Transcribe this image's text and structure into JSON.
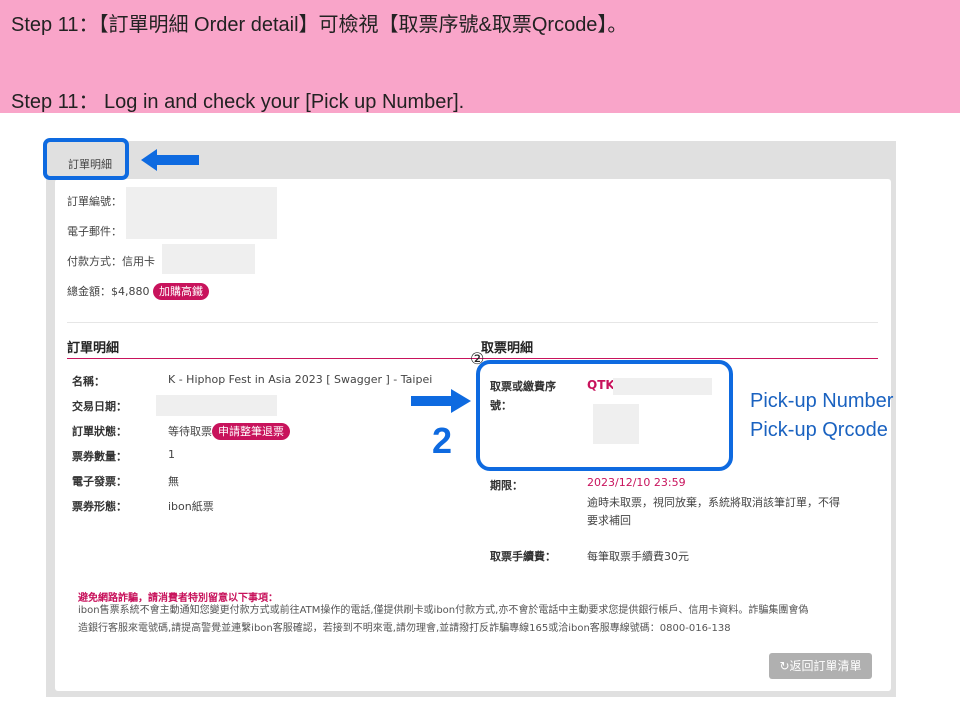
{
  "banner": {
    "line1": "Step 11：【訂單明細 Order detail】可檢視【取票序號&取票Qrcode】。",
    "line2": "Step 11： Log in and check your [Pick up Number]."
  },
  "tab": {
    "label": "訂單明細"
  },
  "summary": {
    "order_no_label": "訂單編號：",
    "email_label": "電子郵件：",
    "payment_label": "付款方式：信用卡",
    "total_label": "總金額：$4,880",
    "upsell_badge": "加購高鐵"
  },
  "order_detail": {
    "title": "訂單明細",
    "rows": [
      {
        "label": "名稱：",
        "value": "K - Hiphop  Fest  in  Asia  2023 [ Swagger ]  - Taipei"
      },
      {
        "label": "交易日期：",
        "value": ""
      },
      {
        "label": "訂單狀態：",
        "value": "等待取票"
      },
      {
        "label": "票券數量：",
        "value": "1"
      },
      {
        "label": "電子發票：",
        "value": "無"
      },
      {
        "label": "票券形態：",
        "value": "ibon紙票"
      }
    ],
    "refund_button": "申請整筆退票"
  },
  "pickup_detail": {
    "title": "取票明細",
    "code_label_1": "取票或繳費序",
    "code_label_2": "號：",
    "code_value": "QTK.",
    "deadline_label": "期限：",
    "deadline_value": "2023/12/10  23:59",
    "deadline_note_1": "逾時未取票，視同放棄，系統將取消該筆訂單，不得",
    "deadline_note_2": "要求補回",
    "fee_label": "取票手續費：",
    "fee_value": "每筆取票手續費30元"
  },
  "annotations": {
    "step_number": "2",
    "circled_number": "②",
    "pickup_number": "Pick-up Number",
    "pickup_qrcode": "Pick-up Qrcode"
  },
  "warning": {
    "title": "避免網路詐騙，請消費者特別留意以下事項：",
    "line1": "ibon售票系統不會主動通知您變更付款方式或前往ATM操作的電話,僅提供刷卡或ibon付款方式,亦不會於電話中主動要求您提供銀行帳戶、信用卡資料。詐騙集團會偽",
    "line2": "造銀行客服來電號碼,請提高警覺並連繫ibon客服確認，若接到不明來電,請勿理會,並請撥打反詐騙專線165或洽ibon客服專線號碼：0800-016-138"
  },
  "back_button": "返回訂單清單",
  "colors": {
    "banner": "#f9a5c9",
    "accent": "#c8135c",
    "highlight": "#0e6ae0"
  }
}
